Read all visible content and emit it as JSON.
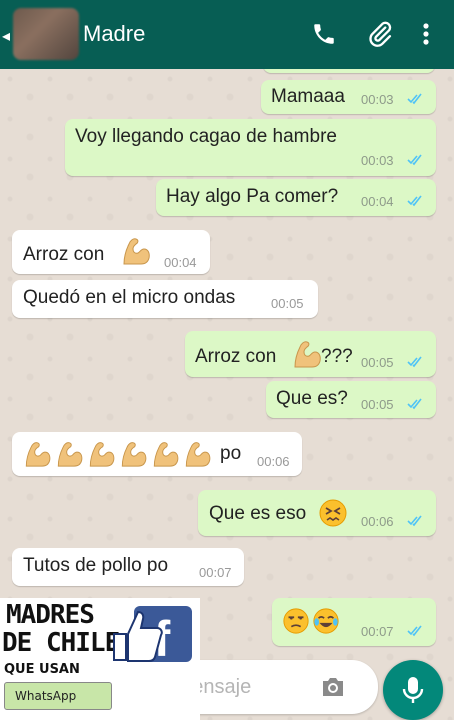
{
  "header": {
    "contact_name": "Madre"
  },
  "messages": [
    {
      "id": "m1",
      "dir": "out",
      "text": "Mamaaa",
      "time": "00:03"
    },
    {
      "id": "m2",
      "dir": "out",
      "text": "Voy llegando cagao de hambre",
      "time": "00:03"
    },
    {
      "id": "m3",
      "dir": "out",
      "text": "Hay algo Pa comer?",
      "time": "00:04"
    },
    {
      "id": "m4",
      "dir": "in",
      "text": "Arroz con",
      "time": "00:04"
    },
    {
      "id": "m5",
      "dir": "in",
      "text": "Quedó en el micro ondas",
      "time": "00:05"
    },
    {
      "id": "m6",
      "dir": "out",
      "text": "Arroz con",
      "suffix": "???",
      "time": "00:05"
    },
    {
      "id": "m7",
      "dir": "out",
      "text": "Que es?",
      "time": "00:05"
    },
    {
      "id": "m8",
      "dir": "in",
      "text": "po",
      "time": "00:06"
    },
    {
      "id": "m9",
      "dir": "out",
      "text": "Que es eso",
      "time": "00:06"
    },
    {
      "id": "m10",
      "dir": "in",
      "text": "Tutos de pollo po",
      "time": "00:07"
    },
    {
      "id": "m11",
      "dir": "out",
      "text": "",
      "time": "00:07"
    }
  ],
  "composer": {
    "placeholder": "be un mensaje"
  },
  "watermark": {
    "line1": "MADRES",
    "line2": "DE CHILE",
    "line3": "QUE USAN",
    "badge": "WhatsApp",
    "fb": "f"
  },
  "colors": {
    "header": "#075e54",
    "outgoing": "#dcf8c6",
    "incoming": "#ffffff",
    "ticks": "#4fc3f7",
    "mic": "#03887a"
  },
  "icons": [
    "back-icon",
    "phone-icon",
    "paperclip-icon",
    "more-vert-icon",
    "double-check-icon",
    "flexed-biceps-emoji",
    "confounded-face-emoji",
    "unamused-face-emoji",
    "tears-of-joy-emoji",
    "camera-icon",
    "mic-icon"
  ]
}
